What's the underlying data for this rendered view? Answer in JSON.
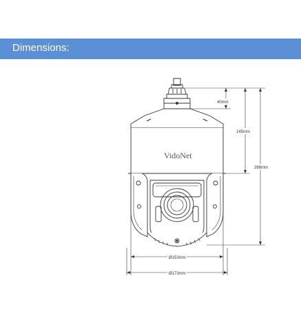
{
  "header": {
    "title": "Dimensions:"
  },
  "camera": {
    "brand": "VidoNet"
  },
  "dimensions": {
    "top_height": "40mm",
    "upper_height": "145mm",
    "total_height": "268mm",
    "inner_diameter": "Ø153mm",
    "outer_diameter": "Ø173mm"
  },
  "colors": {
    "banner": "#5b8fd6",
    "line": "#333333"
  }
}
